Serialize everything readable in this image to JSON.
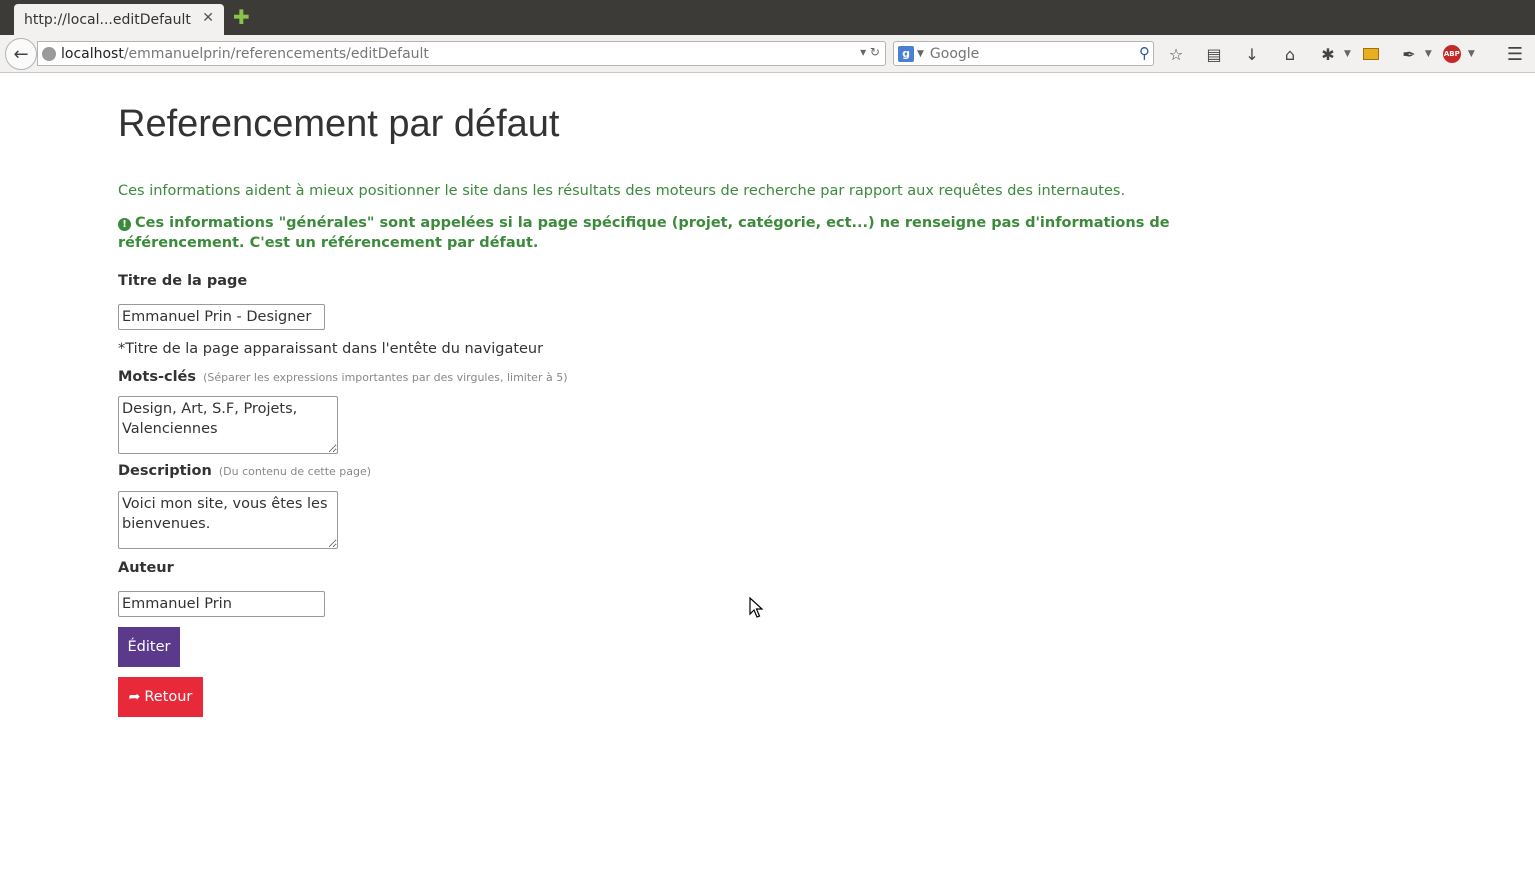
{
  "browser": {
    "tab_title": "http://local...editDefault",
    "tab_close": "✕",
    "new_tab": "✚",
    "url_host": "localhost",
    "url_path": "/emmanuelprin/referencements/editDefault",
    "search_engine": "Google",
    "search_placeholder": "Google",
    "toolbar_icons": [
      "star-icon",
      "reading-list-icon",
      "download-icon",
      "home-icon",
      "extension-icon",
      "ruler-icon",
      "eyedropper-icon",
      "adblock-icon",
      "menu-icon"
    ]
  },
  "page": {
    "title": "Referencement par défaut",
    "info": "Ces informations aident à mieux positionner le site dans les résultats des moteurs de recherche par rapport aux requêtes des internautes.",
    "warning": "Ces informations \"générales\" sont appelées si la page spécifique (projet, catégorie, ect...) ne renseigne pas d'informations de référencement. C'est un référencement par défaut.",
    "fields": {
      "title_label": "Titre de la page",
      "title_value": "Emmanuel Prin - Designer",
      "title_hint": "*Titre de la page apparaissant dans l'entête du navigateur",
      "keywords_label": "Mots-clés",
      "keywords_hint": "(Séparer les expressions importantes par des virgules, limiter à 5)",
      "keywords_value": "Design, Art, S.F, Projets, Valenciennes",
      "description_label": "Description",
      "description_hint": "(Du contenu de cette page)",
      "description_value": "Voici mon site, vous êtes les bienvenues.",
      "author_label": "Auteur",
      "author_value": "Emmanuel Prin"
    },
    "buttons": {
      "edit": "Éditer",
      "back": "Retour"
    }
  },
  "colors": {
    "accent_green": "#3c8a3c",
    "edit_button": "#5b3a8c",
    "back_button": "#e8293a"
  }
}
